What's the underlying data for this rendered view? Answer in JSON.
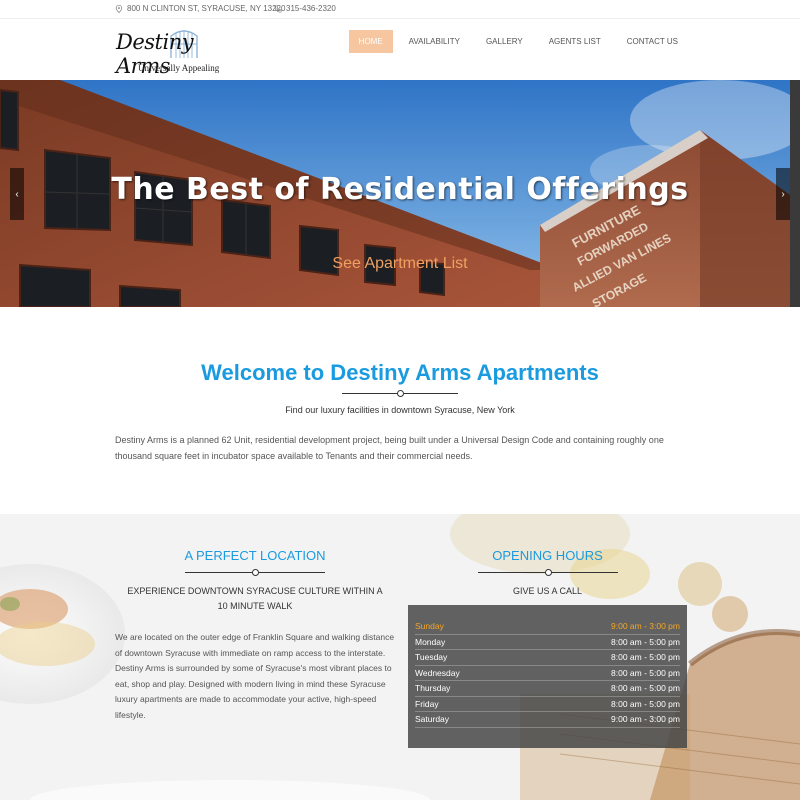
{
  "topbar": {
    "address": "800 N CLINTON ST, SYRACUSE, NY 13220",
    "phone": "315-436-2320"
  },
  "logo": {
    "name": "Destiny Arms",
    "tagline": "Universally Appealing"
  },
  "nav": [
    {
      "label": "HOME",
      "active": true
    },
    {
      "label": "AVAILABILITY"
    },
    {
      "label": "GALLERY"
    },
    {
      "label": "AGENTS LIST"
    },
    {
      "label": "CONTACT US"
    }
  ],
  "hero": {
    "title": "The Best of Residential Offerings",
    "cta": "See Apartment List",
    "prev": "‹",
    "next": "›"
  },
  "welcome": {
    "title": "Welcome to Destiny Arms Apartments",
    "subtitle": "Find our luxury facilities in downtown Syracuse, New York",
    "body": "Destiny Arms is a planned 62 Unit, residential development project, being built under a Universal Design Code and containing roughly one thousand square feet in incubator space available to Tenants and their commercial needs."
  },
  "location": {
    "title": "A PERFECT LOCATION",
    "subtitle": "EXPERIENCE DOWNTOWN SYRACUSE CULTURE WITHIN A 10 MINUTE WALK",
    "body": "We are located on the outer edge of Franklin Square and walking distance of downtown Syracuse with immediate on ramp access to the interstate. Destiny Arms is surrounded by some of Syracuse's most vibrant places to eat, shop and play. Designed with modern living in mind these Syracuse luxury apartments are made to accommodate your active, high-speed lifestyle."
  },
  "hours": {
    "title": "OPENING HOURS",
    "subtitle": "GIVE US A CALL",
    "rows": [
      {
        "day": "Sunday",
        "time": "9:00 am - 3:00 pm"
      },
      {
        "day": "Monday",
        "time": "8:00 am - 5:00 pm"
      },
      {
        "day": "Tuesday",
        "time": "8:00 am - 5:00 pm"
      },
      {
        "day": "Wednesday",
        "time": "8:00 am - 5:00 pm"
      },
      {
        "day": "Thursday",
        "time": "8:00 am - 5:00 pm"
      },
      {
        "day": "Friday",
        "time": "8:00 am - 5:00 pm"
      },
      {
        "day": "Saturday",
        "time": "9:00 am - 3:00 pm"
      }
    ],
    "highlight_color": "#f5a623"
  },
  "colors": {
    "accent_blue": "#1a9be0",
    "nav_active": "#f5c6a0",
    "cta_orange": "#f0a060"
  },
  "icons": {
    "address": "map-pin-icon",
    "phone": "phone-icon"
  }
}
